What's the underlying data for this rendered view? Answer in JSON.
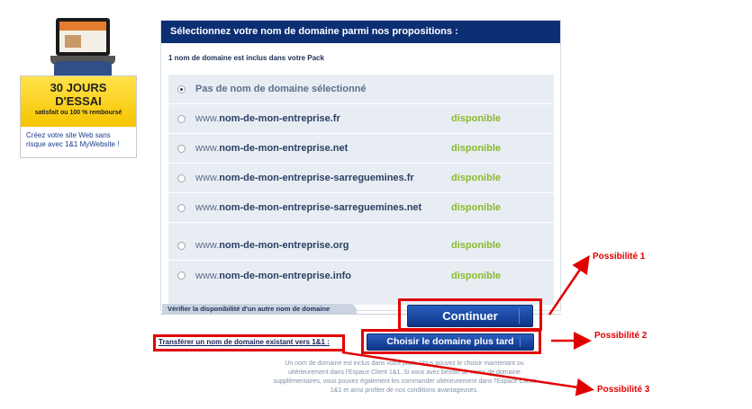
{
  "promo": {
    "line1": "30 JOURS",
    "line2": "D'ESSAI",
    "sub": "satisfait ou 100 % remboursé",
    "text": "Créez votre site Web sans risque avec 1&1 MyWebsite !"
  },
  "panel": {
    "header": "Sélectionnez votre nom de domaine parmi nos propositions :",
    "pack_note": "1 nom de domaine est inclus dans votre Pack"
  },
  "options": [
    {
      "www": "",
      "name": "Pas de nom de domaine sélectionné",
      "status": "",
      "selected": true
    },
    {
      "www": "www.",
      "name": "nom-de-mon-entreprise.fr",
      "status": "disponible",
      "selected": false
    },
    {
      "www": "www.",
      "name": "nom-de-mon-entreprise.net",
      "status": "disponible",
      "selected": false
    },
    {
      "www": "www.",
      "name": "nom-de-mon-entreprise-sarreguemines.fr",
      "status": "disponible",
      "selected": false
    },
    {
      "www": "www.",
      "name": "nom-de-mon-entreprise-sarreguemines.net",
      "status": "disponible",
      "selected": false
    },
    {
      "www": "www.",
      "name": "nom-de-mon-entreprise.org",
      "status": "disponible",
      "selected": false
    },
    {
      "www": "www.",
      "name": "nom-de-mon-entreprise.info",
      "status": "disponible",
      "selected": false
    }
  ],
  "verify_tab": "Vérifier la disponibilité d'un autre nom de domaine",
  "buttons": {
    "continue": "Continuer",
    "later": "Choisir le domaine plus tard"
  },
  "transfer_link": "Transférer un nom de domaine existant vers 1&1 :",
  "footer_note": "Un nom de domaine est inclus dans votre pack. Vous pouvez le choisir maintenant ou ultérieurement dans l'Espace Client 1&1. Si vous avez besoin de noms de domaine supplémentaires, vous pouvez également les commander ultérieurement dans l'Espace Client 1&1 et ainsi profiter de nos conditions avantageuses.",
  "annotations": {
    "p1": "Possibilité 1",
    "p2": "Possibilité 2",
    "p3": "Possibilité 3"
  },
  "colors": {
    "header_bg": "#0c2f74",
    "available": "#8bb92f",
    "annotation": "#e10000"
  }
}
